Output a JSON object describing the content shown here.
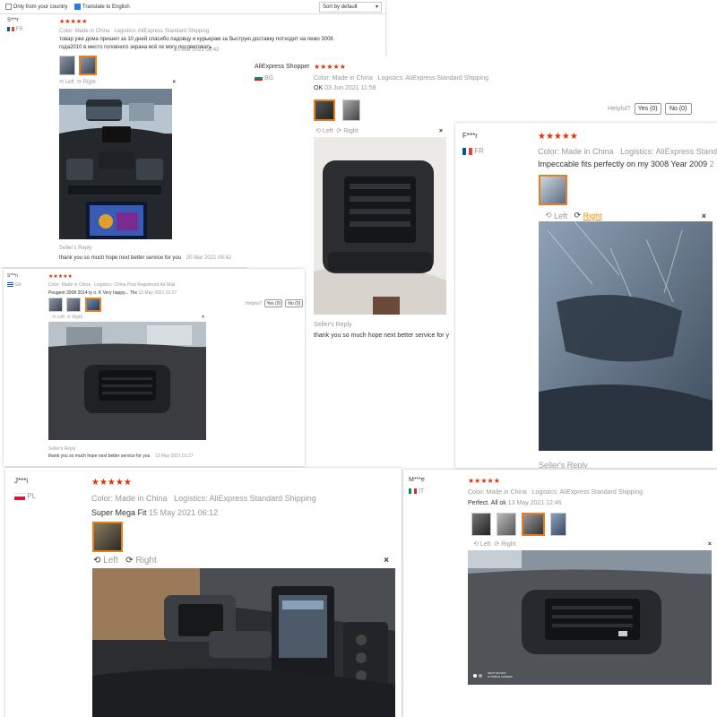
{
  "filter_bar": {
    "only_country_label": "Only from your country",
    "translate_label": "Translate to English",
    "sort_value": "Sort by default"
  },
  "color_label": "Color:",
  "logistics_label": "Logistics:",
  "stars": "★★★★★",
  "seller_reply_label": "Seller's Reply",
  "rotate_left": "Left",
  "rotate_right": "Right",
  "close_glyph": "×",
  "helpful_label": "Helpful?",
  "reviews": {
    "r1": {
      "name": "S***r",
      "country": "FR",
      "color": "Made in China",
      "logistics": "AliExpress Standard Shipping",
      "text": "товар уже дома пришел за 10 дней спасибо падовцу и курьерам за быструю доставку потходит на пежо 3008 года2010 в место головного экрана всё ок могу посоветовать",
      "date": "20 Mar 2021 08:42",
      "reply_text": "thank you so much hope next better service for you",
      "reply_date": "20 Mar 2021 08:42"
    },
    "r2": {
      "name": "AliExpress Shopper",
      "country": "BG",
      "color": "Made in China",
      "logistics": "AliExpress Standard Shipping",
      "text": "OK",
      "date": "03 Jun 2021 11:58",
      "reply_text": "thank you so much hope next better service for y",
      "yes": "Yes (0)",
      "no": "No (0)"
    },
    "r3": {
      "name": "F***r",
      "country": "FR",
      "color": "Made in China",
      "logistics": "AliExpress Stand",
      "text": "Impeccable fits perfectly on my 3008 Year 2009",
      "date": "2",
      "reply_label": "Seller's Reply"
    },
    "r4": {
      "name": "S***n",
      "country": "GR",
      "color": "Made in China",
      "logistics": "China Post Registered Air Mail",
      "text": "Peugeot 3008 2014 ty o. K Very happy... Thx",
      "date": "13 May 2021 01:27",
      "reply_text": "thank you so much hope next better service for you",
      "reply_date": "13 May 2021 01:27",
      "yes": "Yes (0)",
      "no": "No (0)"
    },
    "r5": {
      "name": "J***i",
      "country": "PL",
      "color": "Made in China",
      "logistics": "AliExpress Standard Shipping",
      "text": "Super Mega Fit",
      "date": "15 May 2021 06:12"
    },
    "r6": {
      "name": "M***e",
      "country": "IT",
      "color": "Made in China",
      "logistics": "AliExpress Standard Shipping",
      "text": "Perfect. All ok",
      "date": "13 May 2021 12:46",
      "photo_caption": "SHOT ON MI 8\nAI TRIPLE CAMERA"
    }
  }
}
